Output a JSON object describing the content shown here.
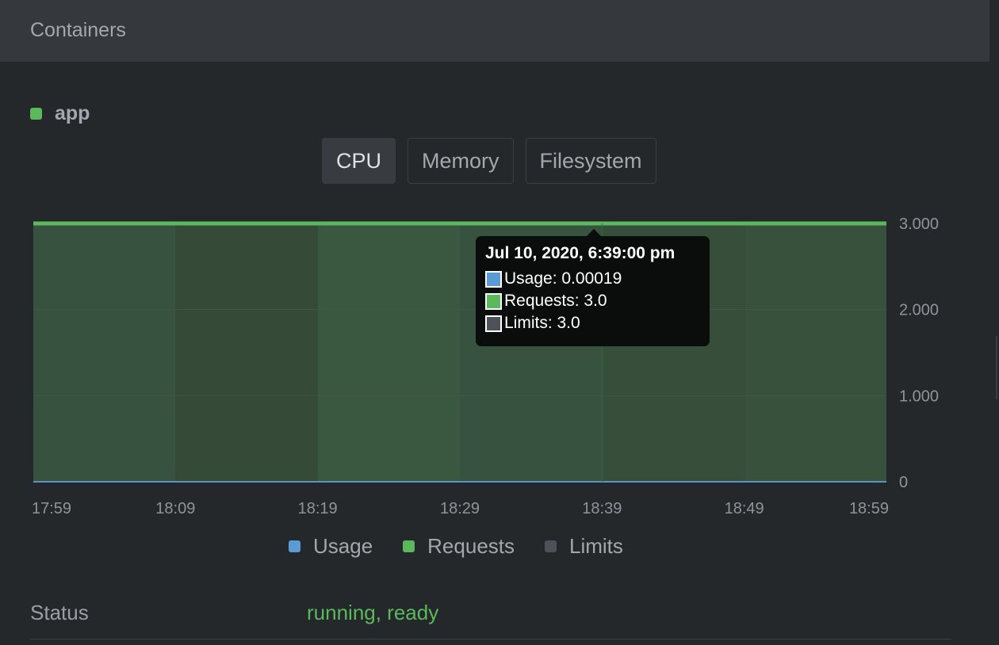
{
  "section": {
    "title": "Containers"
  },
  "container": {
    "name": "app",
    "status_color": "#5cb85c"
  },
  "tabs": [
    {
      "label": "CPU",
      "active": true
    },
    {
      "label": "Memory",
      "active": false
    },
    {
      "label": "Filesystem",
      "active": false
    }
  ],
  "chart_data": {
    "type": "area",
    "x": [
      "17:59",
      "18:09",
      "18:19",
      "18:29",
      "18:39",
      "18:49",
      "18:59"
    ],
    "x_tick_labels": [
      "17:59",
      "18:09",
      "18:19",
      "18:29",
      "18:39",
      "18:49",
      "18:59"
    ],
    "y_tick_labels": [
      "0",
      "1.000",
      "2.000",
      "3.000"
    ],
    "ylim": [
      0,
      3
    ],
    "grid": true,
    "legend_position": "bottom",
    "series": [
      {
        "name": "Usage",
        "color": "#5b9bd5",
        "values": [
          0.0002,
          0.0002,
          0.0002,
          0.0002,
          0.00019,
          0.0002,
          0.0002
        ]
      },
      {
        "name": "Requests",
        "color": "#5cb85c",
        "values": [
          3,
          3,
          3,
          3,
          3,
          3,
          3
        ]
      },
      {
        "name": "Limits",
        "color": "#4d5158",
        "values": [
          3,
          3,
          3,
          3,
          3,
          3,
          3
        ]
      }
    ]
  },
  "tooltip": {
    "title": "Jul 10, 2020, 6:39:00 pm",
    "rows": [
      {
        "text": "Usage: 0.00019",
        "color": "#5b9bd5"
      },
      {
        "text": "Requests: 3.0",
        "color": "#5cb85c"
      },
      {
        "text": "Limits: 3.0",
        "color": "#4d5158"
      }
    ]
  },
  "legend": [
    {
      "label": "Usage",
      "color": "#5b9bd5"
    },
    {
      "label": "Requests",
      "color": "#5cb85c"
    },
    {
      "label": "Limits",
      "color": "#4d5158"
    }
  ],
  "status": {
    "label": "Status",
    "value": "running, ready"
  }
}
